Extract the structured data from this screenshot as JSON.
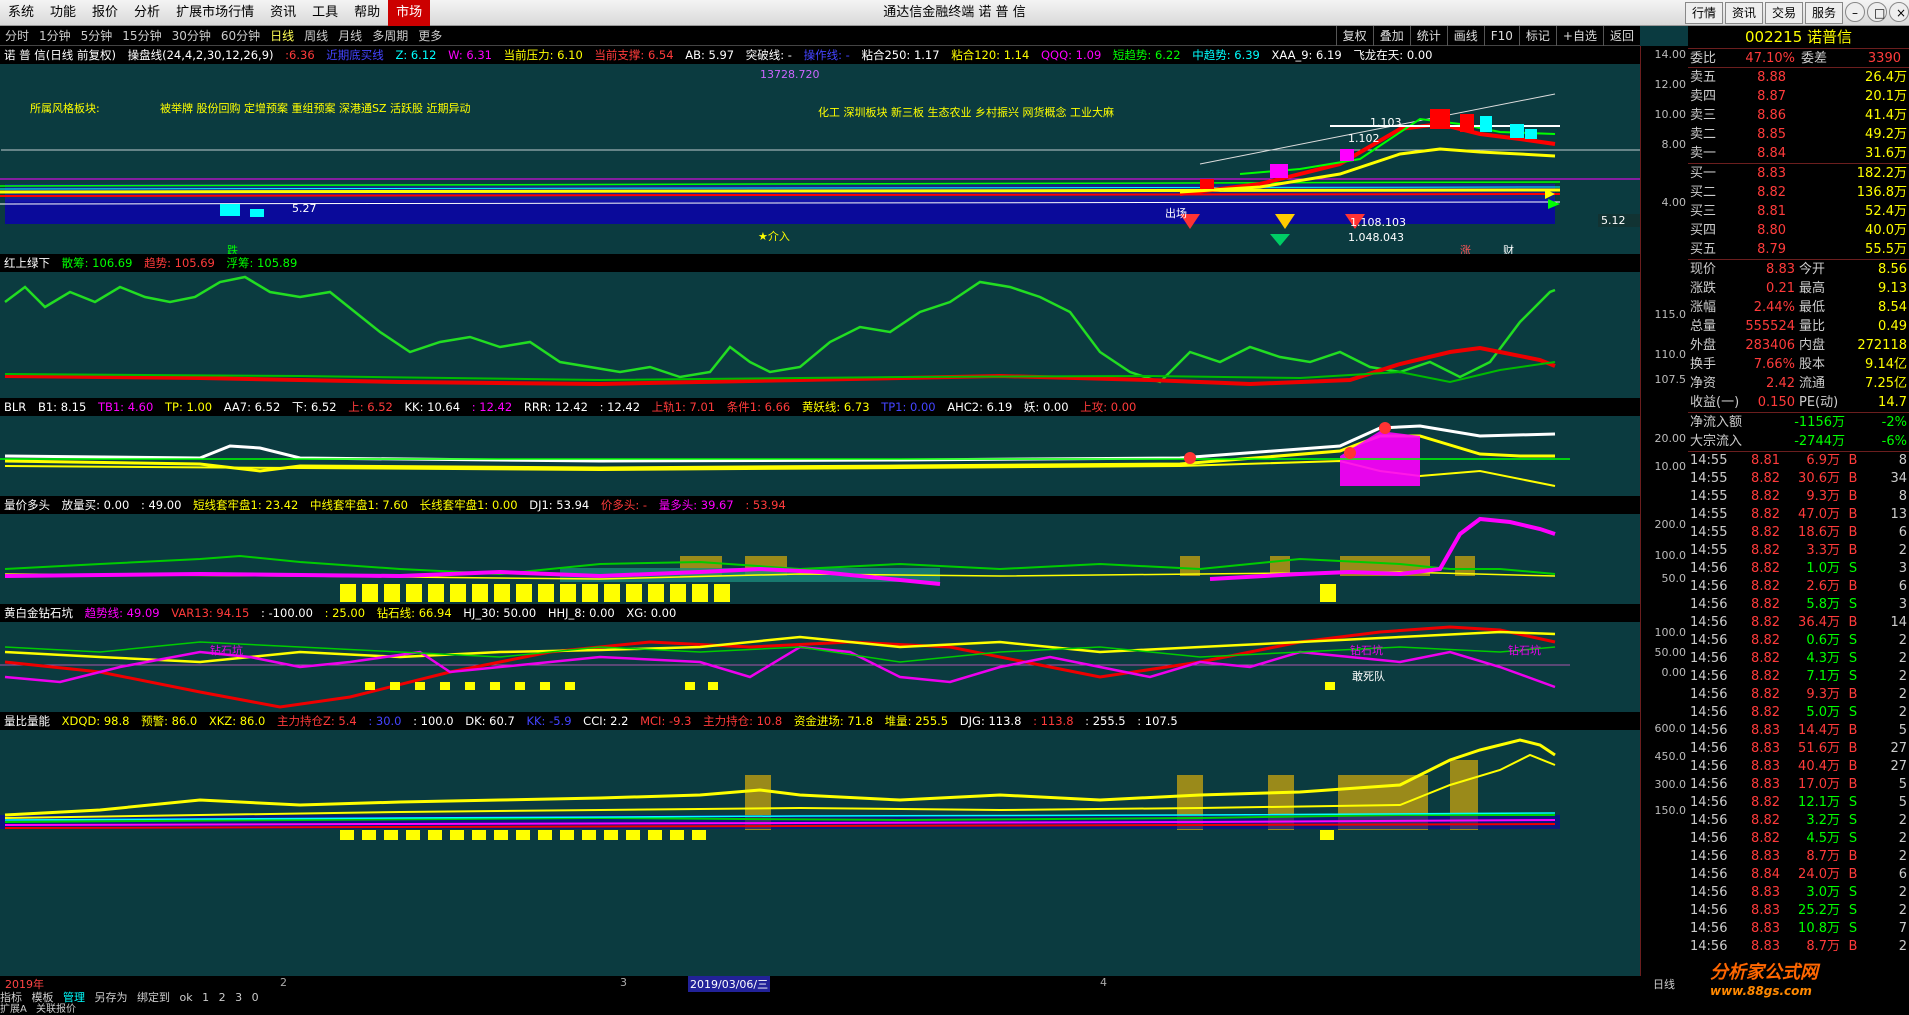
{
  "window": {
    "title": "通达信金融终端 诺 普 信",
    "menu": [
      "系统",
      "功能",
      "报价",
      "分析",
      "扩展市场行情",
      "资讯",
      "工具",
      "帮助",
      "市场"
    ],
    "right_buttons": [
      "行情",
      "资讯",
      "交易",
      "服务"
    ]
  },
  "periods": [
    "分时",
    "1分钟",
    "5分钟",
    "15分钟",
    "30分钟",
    "60分钟",
    "日线",
    "周线",
    "月线",
    "多周期",
    "更多"
  ],
  "period_selected": "日线",
  "tools": [
    "复权",
    "叠加",
    "统计",
    "画线",
    "F10",
    "标记",
    "+自选",
    "返回"
  ],
  "panels": [
    {
      "name": "main",
      "header": [
        "诺 普 信(日线 前复权)",
        "操盘线(24,4,2,30,12,26,9)",
        ":6.36",
        "近期底买线",
        "Z: 6.12",
        "W: 6.31",
        "当前压力: 6.10",
        "当前支撑: 6.54",
        "AB: 5.97",
        "突破线: -",
        "操作线: -",
        "粘合250: 1.17",
        "粘合120: 1.14",
        "QQQ: 1.09",
        "短趋势: 6.22",
        "中趋势: 6.39",
        "XAA_9: 6.19",
        "飞龙在天: 0.00"
      ],
      "notes": [
        "所属风格板块:",
        "被举牌 股份回购 定增预案 重组预案 深港通SZ 活跃股 近期异动",
        "化工 深圳板块 新三板 生态农业 乡村振兴 网货概念 工业大麻",
        "13728.720",
        "★介入",
        "1.103",
        "1.102",
        "1.108.103",
        "1.048.043",
        "5.27",
        "跌",
        "涨",
        "财",
        "出场",
        "5.12"
      ],
      "ylabels": [
        "14.00",
        "12.00",
        "10.00",
        "8.00",
        "4.00"
      ]
    },
    {
      "name": "hslv",
      "header": [
        "红上绿下",
        "散筹: 106.69",
        "趋势: 105.69",
        "浮筹: 105.89"
      ],
      "ylabels": [
        "115.0",
        "110.0",
        "107.5"
      ]
    },
    {
      "name": "blr",
      "header": [
        "BLR",
        "B1: 8.15",
        "TB1: 4.60",
        "TP: 1.00",
        "AA7: 6.52",
        "下: 6.52",
        "上: 6.52",
        "KK: 10.64",
        ": 12.42",
        "RRR: 12.42",
        ": 12.42",
        "上轨1: 7.01",
        "条件1: 6.66",
        "黄妖线: 6.73",
        "TP1: 0.00",
        "AHC2: 6.19",
        "妖: 0.00",
        "上攻: 0.00"
      ],
      "ylabels": [
        "20.00",
        "10.00"
      ]
    },
    {
      "name": "ljdt",
      "header": [
        "量价多头",
        "放量买: 0.00",
        ": 49.00",
        "短线套牢盘1: 23.42",
        "中线套牢盘1: 7.60",
        "长线套牢盘1: 0.00",
        "DJ1: 53.94",
        "价多头: -",
        "量多头: 39.67",
        ": 53.94"
      ],
      "ylabels": [
        "200.0",
        "100.0",
        "50.0"
      ]
    },
    {
      "name": "hbjzsk",
      "header": [
        "黄白金钻石坑",
        "趋势线: 49.09",
        "VAR13: 94.15",
        ": -100.00",
        ": 25.00",
        "钻石线: 66.94",
        "HJ_30: 50.00",
        "HHJ_8: 0.00",
        "XG: 0.00"
      ],
      "notes": [
        "钻石坑",
        "钻石坑",
        "钻石坑",
        "敢死队"
      ],
      "ylabels": [
        "100.0",
        "50.00",
        "0.00"
      ]
    },
    {
      "name": "lbln",
      "header": [
        "量比量能",
        "XDQD: 98.8",
        "预警: 86.0",
        "XKZ: 86.0",
        "主力持仓Z: 5.4",
        ": 30.0",
        ": 100.0",
        "DK: 60.7",
        "KK: -5.9",
        "CCI: 2.2",
        "MCI: -9.3",
        "主力持仓: 10.8",
        "资金进场: 71.8",
        "堆量: 255.5",
        "DJG: 113.8",
        ": 113.8",
        ": 255.5",
        ": 107.5"
      ],
      "ylabels": [
        "600.0",
        "450.0",
        "300.0",
        "150.0"
      ]
    }
  ],
  "xaxis": [
    "2019年",
    "2",
    "3",
    "2019/03/06/三",
    "4"
  ],
  "xaxis_right": "日线",
  "bottom": [
    "指标",
    "模板",
    "管理",
    "另存为",
    "绑定到",
    "ok",
    "1",
    "2",
    "3",
    "0"
  ],
  "bottom2": [
    "扩展A",
    "关联报价"
  ],
  "quote": {
    "code": "002215 诺普信",
    "weibi": {
      "label": "委比",
      "val": "47.10%",
      "label2": "委差",
      "val2": "3390"
    },
    "sell": [
      [
        "卖五",
        "8.88",
        "26.4万"
      ],
      [
        "卖四",
        "8.87",
        "20.1万"
      ],
      [
        "卖三",
        "8.86",
        "41.4万"
      ],
      [
        "卖二",
        "8.85",
        "49.2万"
      ],
      [
        "卖一",
        "8.84",
        "31.6万"
      ]
    ],
    "buy": [
      [
        "买一",
        "8.83",
        "182.2万"
      ],
      [
        "买二",
        "8.82",
        "136.8万"
      ],
      [
        "买三",
        "8.81",
        "52.4万"
      ],
      [
        "买四",
        "8.80",
        "40.0万"
      ],
      [
        "买五",
        "8.79",
        "55.5万"
      ]
    ],
    "stats": [
      [
        "现价",
        "8.83",
        "今开",
        "8.56"
      ],
      [
        "涨跌",
        "0.21",
        "最高",
        "9.13"
      ],
      [
        "涨幅",
        "2.44%",
        "最低",
        "8.54"
      ],
      [
        "总量",
        "555524",
        "量比",
        "0.49"
      ],
      [
        "外盘",
        "283406",
        "内盘",
        "272118"
      ],
      [
        "换手",
        "7.66%",
        "股本",
        "9.14亿"
      ],
      [
        "净资",
        "2.42",
        "流通",
        "7.25亿"
      ],
      [
        "收益(一)",
        "0.150",
        "PE(动)",
        "14.7"
      ]
    ],
    "flow": [
      [
        "净流入额",
        "-1156万",
        "-2%"
      ],
      [
        "大宗流入",
        "-2744万",
        "-6%"
      ]
    ],
    "ticks": [
      [
        "14:55",
        "8.81",
        "6.9万",
        "B",
        "8"
      ],
      [
        "14:55",
        "8.82",
        "30.6万",
        "B",
        "34"
      ],
      [
        "14:55",
        "8.82",
        "9.3万",
        "B",
        "8"
      ],
      [
        "14:55",
        "8.82",
        "47.0万",
        "B",
        "13"
      ],
      [
        "14:55",
        "8.82",
        "18.6万",
        "B",
        "6"
      ],
      [
        "14:55",
        "8.82",
        "3.3万",
        "B",
        "2"
      ],
      [
        "14:56",
        "8.82",
        "1.0万",
        "S",
        "3"
      ],
      [
        "14:56",
        "8.82",
        "2.6万",
        "B",
        "6"
      ],
      [
        "14:56",
        "8.82",
        "5.8万",
        "S",
        "3"
      ],
      [
        "14:56",
        "8.82",
        "36.4万",
        "B",
        "14"
      ],
      [
        "14:56",
        "8.82",
        "0.6万",
        "S",
        "2"
      ],
      [
        "14:56",
        "8.82",
        "4.3万",
        "S",
        "2"
      ],
      [
        "14:56",
        "8.82",
        "7.1万",
        "S",
        "2"
      ],
      [
        "14:56",
        "8.82",
        "9.3万",
        "B",
        "2"
      ],
      [
        "14:56",
        "8.82",
        "5.0万",
        "S",
        "2"
      ],
      [
        "14:56",
        "8.83",
        "14.4万",
        "B",
        "5"
      ],
      [
        "14:56",
        "8.83",
        "51.6万",
        "B",
        "27"
      ],
      [
        "14:56",
        "8.83",
        "40.4万",
        "B",
        "27"
      ],
      [
        "14:56",
        "8.83",
        "17.0万",
        "B",
        "5"
      ],
      [
        "14:56",
        "8.82",
        "12.1万",
        "S",
        "5"
      ],
      [
        "14:56",
        "8.82",
        "3.2万",
        "S",
        "2"
      ],
      [
        "14:56",
        "8.82",
        "4.5万",
        "S",
        "2"
      ],
      [
        "14:56",
        "8.83",
        "8.7万",
        "B",
        "2"
      ],
      [
        "14:56",
        "8.84",
        "24.0万",
        "B",
        "6"
      ],
      [
        "14:56",
        "8.83",
        "3.0万",
        "S",
        "2"
      ],
      [
        "14:56",
        "8.83",
        "25.2万",
        "S",
        "2"
      ],
      [
        "14:56",
        "8.83",
        "10.8万",
        "S",
        "7"
      ],
      [
        "14:56",
        "8.83",
        "8.7万",
        "B",
        "2"
      ]
    ]
  },
  "watermark": {
    "text": "分析家公式网",
    "url": "www.88gs.com"
  }
}
